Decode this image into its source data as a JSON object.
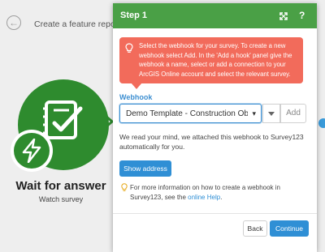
{
  "background": {
    "title": "Create a feature report",
    "module": {
      "name": "Wait for answer",
      "subtitle": "Watch survey",
      "color": "#2e8b2e"
    }
  },
  "panel": {
    "title": "Step 1",
    "header_color": "#4aa046",
    "tooltip": "Select the webhook for your survey. To create a new webhook select Add. In the 'Add a hook' panel give the webhook a name, select or add a connection to your ArcGIS Online account and select the relevant survey.",
    "webhook": {
      "label": "Webhook",
      "selected": "Demo Template - Construction Ob",
      "add_label": "Add"
    },
    "info": "We read your mind, we attached this webhook to Survey123 automatically for you.",
    "show_address_label": "Show address",
    "note": {
      "text_before": "For more information on how to create a webhook in Survey123, see the ",
      "link": "online Help",
      "text_after": "."
    },
    "footer": {
      "back_label": "Back",
      "continue_label": "Continue"
    },
    "accent_color": "#2f8fd5",
    "tooltip_color": "#f26b5b"
  }
}
